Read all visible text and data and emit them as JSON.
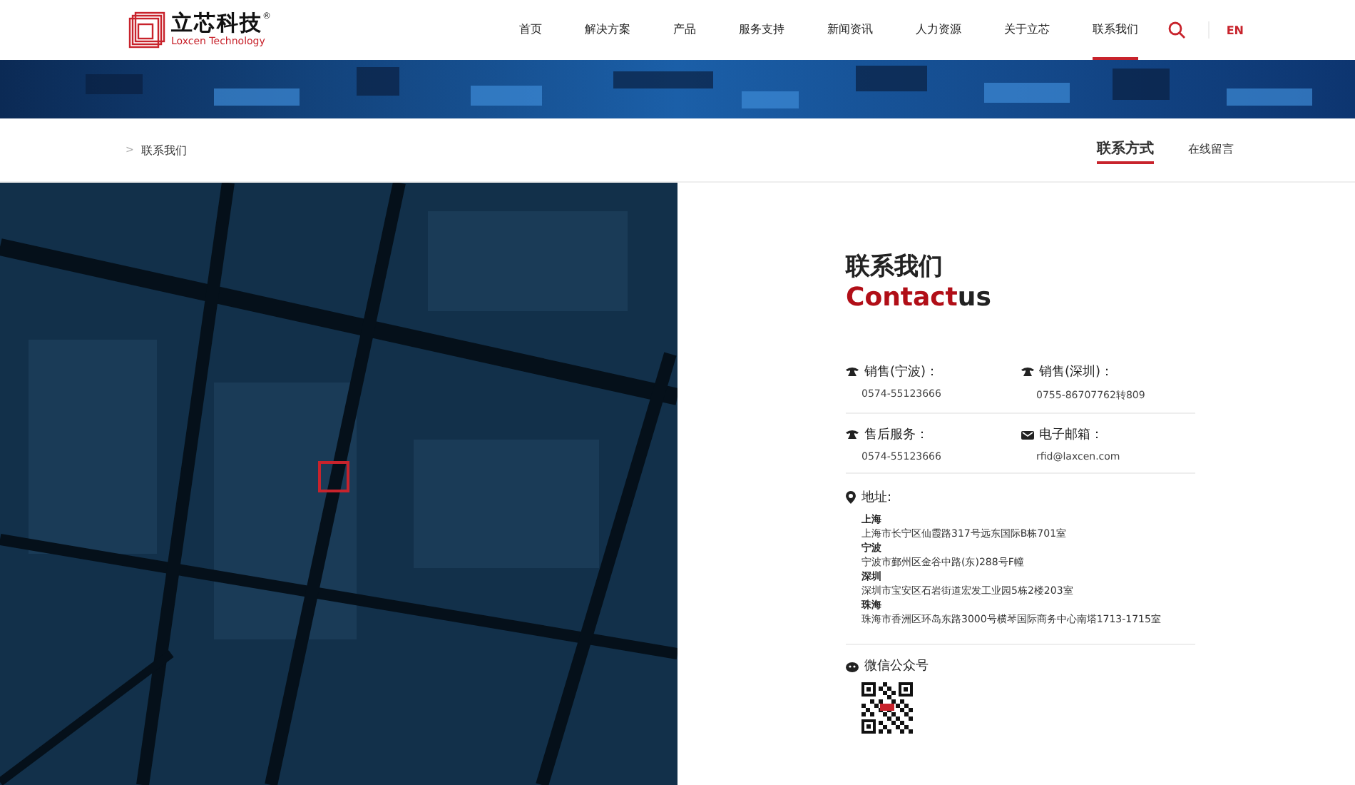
{
  "header": {
    "logo": {
      "name": "立芯科技",
      "mark": "®",
      "subtitle": "Loxcen Technology"
    },
    "nav": [
      {
        "label": "首页",
        "selected": false
      },
      {
        "label": "解决方案",
        "selected": false
      },
      {
        "label": "产品",
        "selected": false
      },
      {
        "label": "服务支持",
        "selected": false
      },
      {
        "label": "新闻资讯",
        "selected": false
      },
      {
        "label": "人力资源",
        "selected": false
      },
      {
        "label": "关于立芯",
        "selected": false
      },
      {
        "label": "联系我们",
        "selected": true
      }
    ],
    "language": "EN"
  },
  "breadcrumb": {
    "separator": ">",
    "label": "联系我们"
  },
  "subnav": [
    {
      "label": "联系方式",
      "selected": true
    },
    {
      "label": "在线留言",
      "selected": false
    }
  ],
  "contact": {
    "title_cn": "联系我们",
    "title_en_accent": "Contact",
    "title_en_rest": "us",
    "items": [
      {
        "kind": "phone",
        "label": "销售(宁波)：",
        "value": "0574-55123666"
      },
      {
        "kind": "phone",
        "label": "销售(深圳)：",
        "value": "0755-86707762转809"
      },
      {
        "kind": "phone",
        "label": "售后服务：",
        "value": "0574-55123666"
      },
      {
        "kind": "email",
        "label": "电子邮箱：",
        "value": "rfid@laxcen.com"
      }
    ],
    "address": {
      "label": "地址:",
      "entries": [
        {
          "city": "上海",
          "line": "上海市长宁区仙霞路317号远东国际B栋701室"
        },
        {
          "city": "宁波",
          "line": "宁波市鄞州区金谷中路(东)288号F幢"
        },
        {
          "city": "深圳",
          "line": "深圳市宝安区石岩街道宏发工业园5栋2楼203室"
        },
        {
          "city": "珠海",
          "line": "珠海市香洲区环岛东路3000号横琴国际商务中心南塔1713-1715室"
        }
      ]
    },
    "wechat": {
      "label": "微信公众号"
    }
  }
}
